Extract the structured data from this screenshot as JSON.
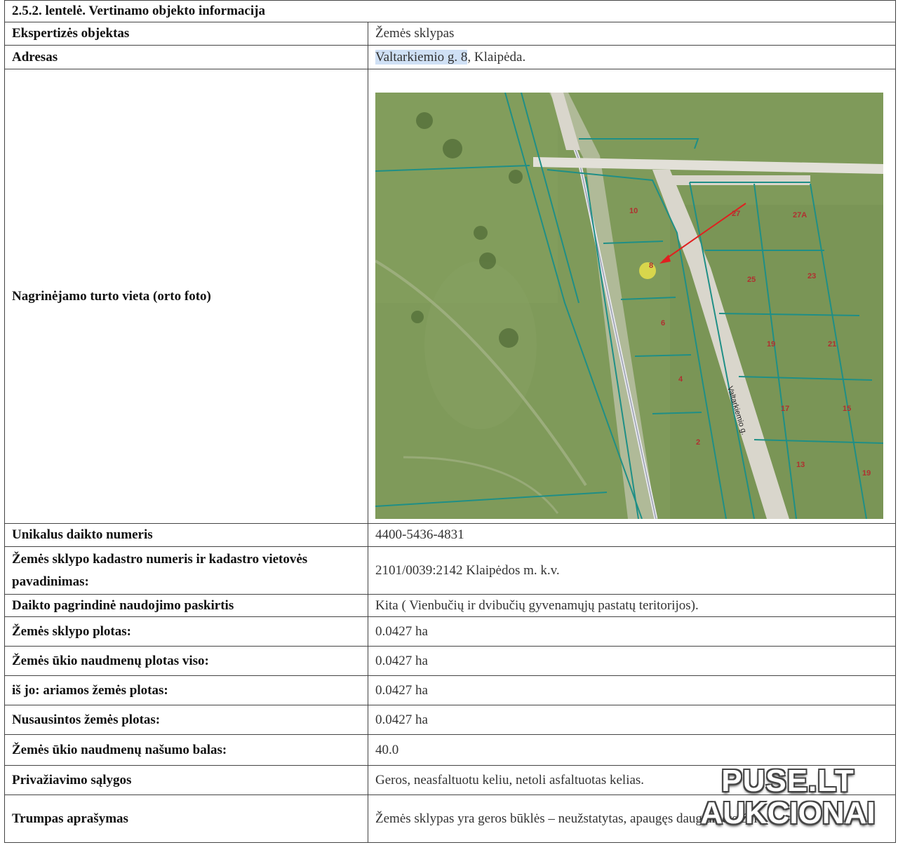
{
  "title": "2.5.2. lentelė. Vertinamo objekto informacija",
  "rows": {
    "objektas": {
      "label": "Ekspertizės objektas",
      "value": "Žemės sklypas"
    },
    "adresas": {
      "label": "Adresas",
      "value_highlight": "Valtarkiemio g. 8",
      "value_rest": ", Klaipėda."
    },
    "vieta": {
      "label": "Nagrinėjamo turto vieta (orto foto)"
    },
    "unikalus": {
      "label": "Unikalus daikto numeris",
      "value": "4400-5436-4831"
    },
    "kadastras": {
      "label": "Žemės sklypo kadastro numeris ir kadastro vietovės pavadinimas:",
      "value": "2101/0039:2142 Klaipėdos m. k.v."
    },
    "paskirtis": {
      "label": "Daikto pagrindinė naudojimo paskirtis",
      "value": "Kita ( Vienbučių ir dvibučių gyvenamųjų pastatų teritorijos)."
    },
    "plotas": {
      "label": "Žemės sklypo plotas:",
      "value": "0.0427 ha"
    },
    "naudmenu": {
      "label": "Žemės ūkio naudmenų plotas viso:",
      "value": "0.0427 ha"
    },
    "ariamos": {
      "label": "iš jo: ariamos žemės plotas:",
      "value": "0.0427 ha"
    },
    "nusausintos": {
      "label": "Nusausintos žemės plotas:",
      "value": "0.0427 ha"
    },
    "balas": {
      "label": "Žemės ūkio naudmenų našumo balas:",
      "value": "40.0"
    },
    "privaziavimo": {
      "label": "Privažiavimo sąlygos",
      "value": "Geros, neasfaltuotu keliu, netoli asfaltuotas kelias."
    },
    "aprasymas": {
      "label": "Trumpas aprašymas",
      "value": "Žemės sklypas yra geros būklės – neužstatytas, apaugęs daugiamete žole."
    }
  },
  "map": {
    "street_label": "Valtarkiemio g.",
    "parcel_numbers": [
      "10",
      "8",
      "6",
      "4",
      "2",
      "27",
      "27A",
      "25",
      "23",
      "19",
      "21",
      "17",
      "15",
      "13",
      "19"
    ],
    "colors": {
      "grass": "#7f9a5a",
      "boundary": "#1f8f86",
      "road": "#d9d6cc",
      "marker": "#e8e14a",
      "arrow": "#e02020"
    }
  },
  "watermark": {
    "line1": "PUSE.LT",
    "line2": "AUKCIONAI"
  }
}
